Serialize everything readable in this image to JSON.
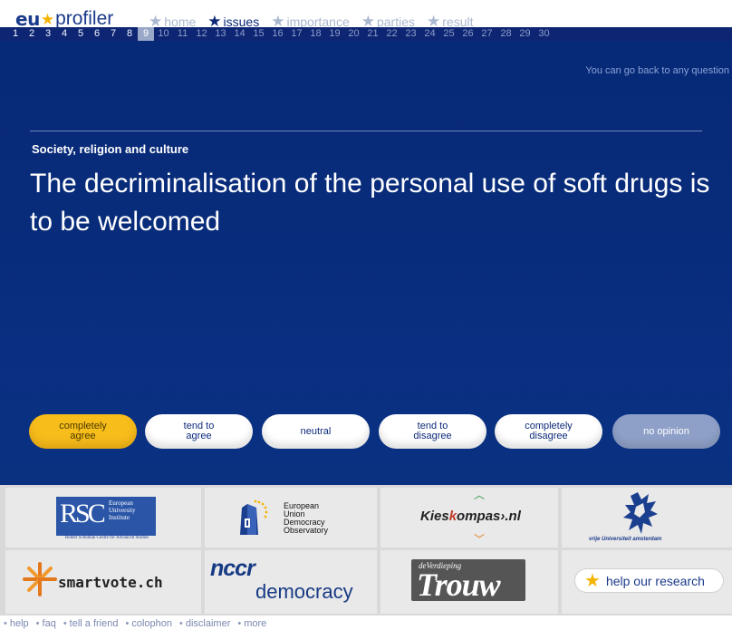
{
  "header": {
    "logo": {
      "eu": "eu",
      "word": "profiler"
    },
    "nav": [
      {
        "label": "home",
        "active": false
      },
      {
        "label": "issues",
        "active": true
      },
      {
        "label": "importance",
        "active": false
      },
      {
        "label": "parties",
        "active": false
      },
      {
        "label": "result",
        "active": false
      }
    ]
  },
  "questions": {
    "numbers": [
      "1",
      "2",
      "3",
      "4",
      "5",
      "6",
      "7",
      "8",
      "9",
      "10",
      "11",
      "12",
      "13",
      "14",
      "15",
      "16",
      "17",
      "18",
      "19",
      "20",
      "21",
      "22",
      "23",
      "24",
      "25",
      "26",
      "27",
      "28",
      "29",
      "30"
    ],
    "current": 9
  },
  "panel": {
    "back_note": "You can go back to any question",
    "category": "Society, religion and culture",
    "statement": "The decriminalisation of the personal use of soft drugs is to be welcomed"
  },
  "answers": [
    {
      "label": "completely\nagree",
      "selected": true
    },
    {
      "label": "tend to\nagree",
      "selected": false
    },
    {
      "label": "neutral",
      "selected": false
    },
    {
      "label": "tend to\ndisagree",
      "selected": false
    },
    {
      "label": "completely\ndisagree",
      "selected": false
    },
    {
      "label": "no opinion",
      "selected": false
    }
  ],
  "partners": {
    "rscas": {
      "mono": "RSC",
      "text": "European University Institute",
      "sub": "Robert Schuman Centre for Advanced Studies"
    },
    "eudo": {
      "lines": [
        "European",
        "Union",
        "Democracy",
        "Observatory"
      ]
    },
    "kieskompas": {
      "pre": "Kies",
      "accent": "k",
      "post": "ompas›.nl"
    },
    "vu": {
      "text": "vrije Universiteit  amsterdam"
    },
    "smartvote": {
      "text": "smartvote.ch"
    },
    "nccr": {
      "top": "nccr",
      "bottom": "democracy"
    },
    "trouw": {
      "small": "deVerdieping",
      "big": "Trouw"
    },
    "help": {
      "label": "help our research"
    }
  },
  "footer": {
    "links": [
      "help",
      "faq",
      "tell a friend",
      "colophon",
      "disclaimer",
      "more"
    ]
  },
  "colors": {
    "brand_blue": "#0d2a7a",
    "panel_blue": "#082b7a",
    "selected_yellow": "#f7bd1b",
    "star_gold": "#f5b400"
  }
}
